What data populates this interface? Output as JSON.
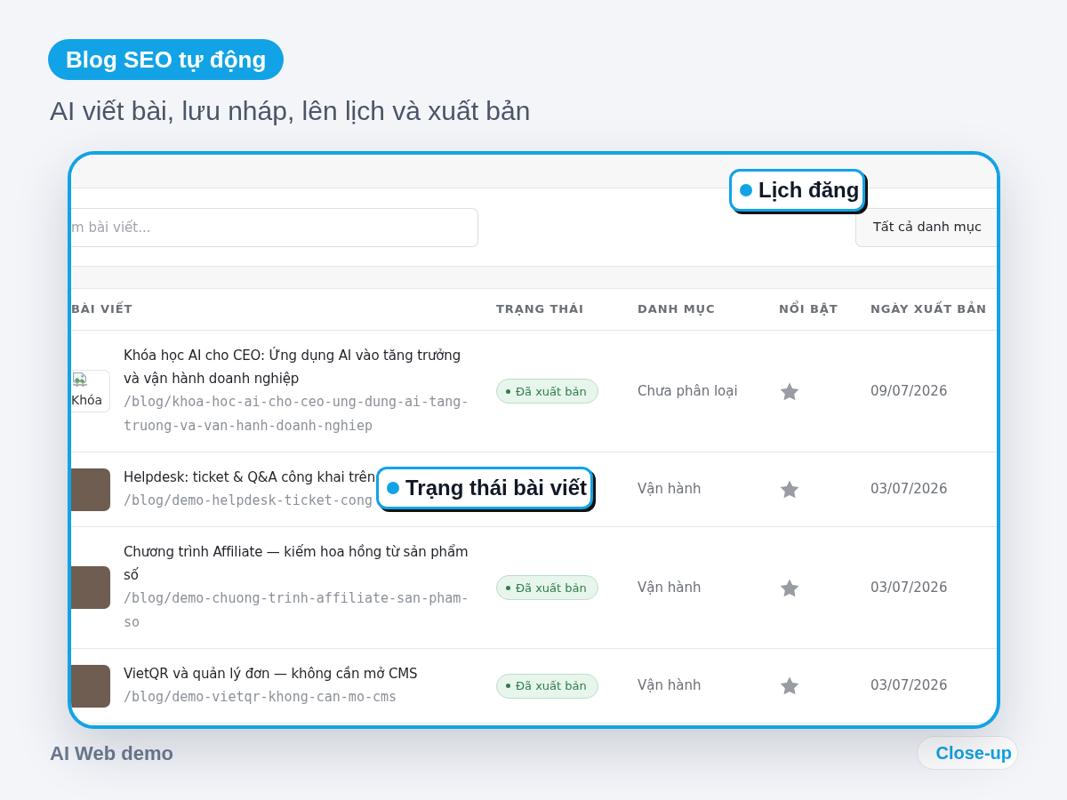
{
  "header": {
    "tag": "Blog SEO tự động",
    "subtitle": "AI viết bài, lưu nháp, lên lịch và xuất bản"
  },
  "screen": {
    "search": {
      "placeholder": "m bài viết..."
    },
    "category_filter": "Tất cả danh mục",
    "table": {
      "columns": [
        "BÀI VIẾT",
        "TRẠNG THÁI",
        "DANH MỤC",
        "NỔI BẬT",
        "NGÀY XUẤT BẢN"
      ],
      "rows": [
        {
          "thumbnail": {
            "kind": "broken",
            "alt": "Khóa"
          },
          "title": "Khóa học AI cho CEO: Ứng dụng AI vào tăng trưởng và vận hành doanh nghiệp",
          "slug": "/blog/khoa-hoc-ai-cho-ceo-ung-dung-ai-tang-truong-va-van-hanh-doanh-nghiep",
          "status": "Đã xuất bản",
          "category": "Chưa phân loại",
          "featured": false,
          "date": "09/07/2026"
        },
        {
          "thumbnail": {
            "kind": "photo"
          },
          "title": "Helpdesk: ticket & Q&A công khai trên",
          "slug": "/blog/demo-helpdesk-ticket-cong",
          "category": "Vận hành",
          "featured": false,
          "date": "03/07/2026"
        },
        {
          "thumbnail": {
            "kind": "photo"
          },
          "title": "Chương trình Affiliate — kiếm hoa hồng từ sản phẩm số",
          "slug": "/blog/demo-chuong-trinh-affiliate-san-pham-so",
          "status": "Đã xuất bản",
          "category": "Vận hành",
          "featured": false,
          "date": "03/07/2026"
        },
        {
          "thumbnail": {
            "kind": "photo"
          },
          "title": "VietQR và quản lý đơn — không cần mở CMS",
          "slug": "/blog/demo-vietqr-khong-can-mo-cms",
          "status": "Đã xuất bản",
          "category": "Vận hành",
          "featured": false,
          "date": "03/07/2026"
        }
      ]
    }
  },
  "callouts": [
    {
      "text": "Lịch đăng"
    },
    {
      "text": "Trạng thái bài viết"
    }
  ],
  "footer": {
    "caption": "AI Web demo",
    "badge": "Close-up"
  }
}
